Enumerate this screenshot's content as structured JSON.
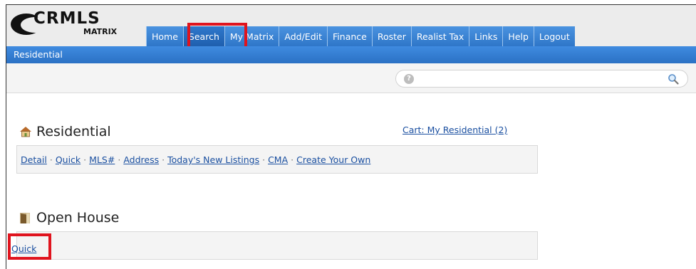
{
  "header": {
    "logo": {
      "brand": "CRMLS",
      "sub": "MATRIX"
    },
    "nav": [
      "Home",
      "Search",
      "My Matrix",
      "Add/Edit",
      "Finance",
      "Roster",
      "Realist Tax",
      "Links",
      "Help",
      "Logout"
    ],
    "active_tab": "Search",
    "subnav": "Residential"
  },
  "search": {
    "placeholder": ""
  },
  "residential": {
    "title": "Residential",
    "cart_link": "Cart: My Residential (2)",
    "links": [
      "Detail",
      "Quick",
      "MLS#",
      "Address",
      "Today's New Listings",
      "CMA",
      "Create Your Own"
    ]
  },
  "open_house": {
    "title": "Open House",
    "links": [
      "Quick"
    ]
  },
  "colors": {
    "nav_blue": "#2f76c8",
    "highlight_red": "#e0141e",
    "link_blue": "#1a4fa0"
  }
}
